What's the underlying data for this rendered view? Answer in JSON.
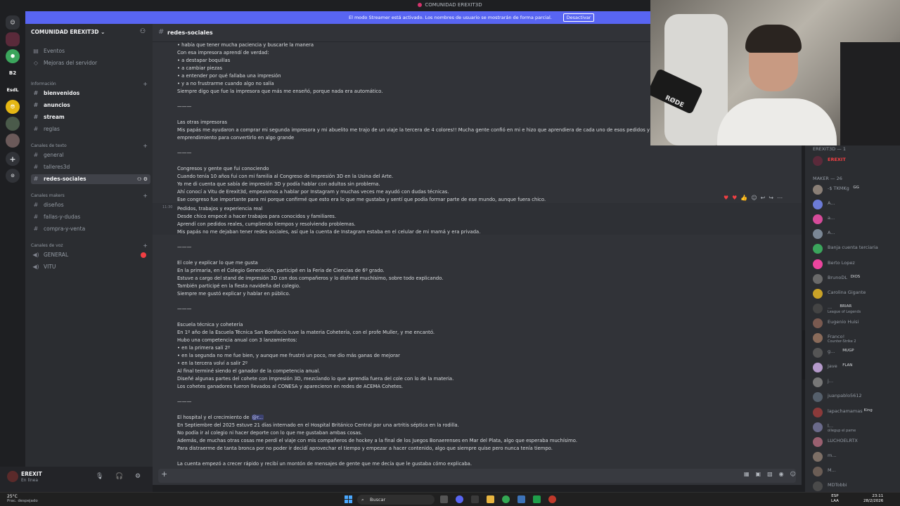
{
  "window": {
    "title": "COMUNIDAD EREXIT3D"
  },
  "servers": [
    "B2",
    "EsdL"
  ],
  "banner": {
    "text": "El modo Streamer está activado. Los nombres de usuario se mostrarán de forma parcial.",
    "button": "Desactivar"
  },
  "sidebar": {
    "guild": "COMUNIDAD EREXIT3D",
    "top_items": [
      "Eventos",
      "Mejoras del servidor"
    ],
    "categories": {
      "info": "Información",
      "texto": "Canales de texto",
      "makers": "Canales makers",
      "voz": "Canales de voz"
    },
    "info_channels": [
      "bienvenidos",
      "anuncios",
      "stream",
      "reglas"
    ],
    "text_channels": [
      "general",
      "talleres3d",
      "redes-sociales"
    ],
    "maker_channels": [
      "diseños",
      "fallas-y-dudas",
      "compra-y-venta"
    ],
    "voice_channels": [
      "GENERAL",
      "VITU"
    ]
  },
  "user": {
    "name": "EREXIT",
    "status": "En línea"
  },
  "channel": {
    "name": "redes-sociales"
  },
  "chat": {
    "lines": [
      "• había que tener mucha paciencia y buscarle la manera",
      "Con esa impresora aprendí de verdad:",
      "• a destapar boquillas",
      "• a cambiar piezas",
      "• a entender por qué fallaba una impresión",
      "• y a no frustrarme cuando algo no salía",
      "Siempre digo que fue la impresora que más me enseñó, porque nada era automático.",
      "———",
      "Las otras impresoras",
      "Mis papás me ayudaron a comprar mi segunda impresora y mi abuelito me trajo de un viaje la tercera de 4 colores!! Mucha gente confió en mi e hizo que aprendiera de cada uno de esos pedidos y así fu",
      "emprendimiento para convertirlo en algo grande",
      "———",
      "Congresos y gente que fui conociendo",
      "Cuando tenía 10 años fui con mi familia al Congreso de Impresión 3D en la Usina del Arte.",
      "Yo me di cuenta que sabía de impresión 3D y podía hablar con adultos sin problema.",
      "Ahí conocí a Vitu de Erexit3d, empezamos a hablar por Instagram y muchas veces me ayudó con dudas técnicas.",
      "Ese congreso fue importante para mi porque confirmé que esto era lo que me gustaba y sentí que podía formar parte de ese mundo, aunque fuera chico.",
      "Pedidos, trabajos y experiencia real",
      "Desde chico empecé a hacer trabajos para conocidos y familiares.",
      "Aprendí con pedidos reales, cumpliendo tiempos y resolviendo problemas.",
      "Mis papás no me dejaban tener redes sociales, así que la cuenta de Instagram estaba en el celular de mi mamá y era privada.",
      "———",
      "El cole y explicar lo que me gusta",
      "En la primaria, en el Colegio Generación, participé en la Feria de Ciencias de 6º grado.",
      "Estuve a cargo del stand de impresión 3D con dos compañeros y lo disfruté muchísimo, sobre todo explicando.",
      "También participé en la fiesta navideña del colegio.",
      "Siempre me gustó explicar y hablar en público.",
      "———",
      "Escuela técnica y cohetería",
      "En 1º año de la Escuela Técnica San Bonifacio tuve la materia Cohetería, con el profe Muller, y me encantó.",
      "Hubo una competencia anual con 3 lanzamientos:",
      "• en la primera salí 2º",
      "• en la segunda no me fue bien, y aunque me frustró un poco, me dio más ganas de mejorar",
      "• en la tercera volví a salir 2º",
      "Al final terminé siendo el ganador de la competencia anual.",
      "Diseñé algunas partes del cohete con impresión 3D, mezclando lo que aprendía fuera del cole con lo de la materia.",
      "Los cohetes ganadores fueron llevados al CONESA y aparecieron en redes de ACEMA Cohetes.",
      "———",
      "El hospital y el crecimiento de",
      "En Septiembre del 2025 estuve 21 días internado en el Hospital Británico Central por una artritis séptica en la rodilla.",
      "No podía ir al colegio ni hacer deporte con lo que me gustaban ambas cosas.",
      "Además, de muchas otras cosas me perdí el viaje con mis compañeros de hockey a la final de los Juegos Bonaerenses en Mar del Plata, algo que esperaba muchísimo.",
      "Para distraerme de tanta bronca por no poder ir decidí aprovechar el tiempo y empezar a hacer contenido, algo que siempre quise pero nunca tenía tiempo.",
      "La cuenta empezó a crecer rápido y recibí un montón de mensajes de gente que me decía que le gustaba cómo explicaba."
    ],
    "mention": "@r...",
    "timestamp": "11:30"
  },
  "members": {
    "group1": "EREXIT3D — 1",
    "owner": "EREXIT",
    "group2": "MAKER — 26",
    "list": [
      {
        "name": "-$ TKMKg",
        "tag": "GG",
        "color": "#8a7f76"
      },
      {
        "name": "A...",
        "color": "#6c7bd6"
      },
      {
        "name": "a...",
        "color": "#d64b9a"
      },
      {
        "name": "A...",
        "color": "#7b8795"
      },
      {
        "name": "Banja cuenta terciaria",
        "color": "#3ba55c"
      },
      {
        "name": "Berto Lopez",
        "color": "#eb459e"
      },
      {
        "name": "BrunoDL",
        "tag": "DIOS",
        "color": "#6a6a6a"
      },
      {
        "name": "Carolina Gigante",
        "color": "#c9a227"
      },
      {
        "name": "...",
        "tag": "BRIAR",
        "sub": "League of Legends",
        "color": "#444"
      },
      {
        "name": "Eugenio Huisi",
        "color": "#7a5a50"
      },
      {
        "name": "Franco!",
        "sub": "Counter-Strike 2",
        "color": "#8a6b5a"
      },
      {
        "name": "g...",
        "tag": "MUGP",
        "color": "#555"
      },
      {
        "name": "Jave",
        "tag": "FLAN",
        "color": "#b59acb"
      },
      {
        "name": "j...",
        "color": "#777"
      },
      {
        "name": "juanpablo5612",
        "color": "#555f6b"
      },
      {
        "name": "lapachamamas",
        "tag": "King",
        "color": "#8b3a3a"
      },
      {
        "name": "l...",
        "sub": "ollegup el pame",
        "color": "#6a6a8a"
      },
      {
        "name": "LUCHOELRTX",
        "color": "#9a6070"
      },
      {
        "name": "m...",
        "color": "#7d6f66"
      },
      {
        "name": "M...",
        "color": "#6b5d55"
      },
      {
        "name": "MDTobbi",
        "color": "#4a4a4a"
      }
    ]
  },
  "taskbar": {
    "temp": "25°C",
    "weather": "Prac. despejado",
    "search": "Buscar",
    "lang1": "ESP",
    "lang2": "LAA",
    "time": "23:11",
    "date": "28/2/2026"
  },
  "camera": {
    "mic_brand": "RØDE"
  }
}
